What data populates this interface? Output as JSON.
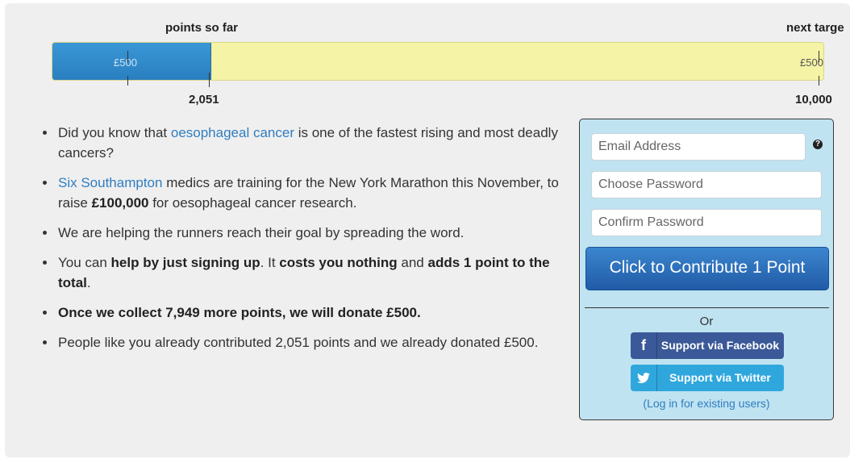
{
  "progress": {
    "label_left": "points so far",
    "label_right": "next targe",
    "fill_fraction": 0.205,
    "current_marker_label": "£500",
    "target_marker_label": "£500",
    "current_points": "2,051",
    "target_points": "10,000",
    "colors": {
      "fill": "#2a7fc0",
      "track": "#f5f3a6"
    }
  },
  "facts": [
    {
      "pre": "Did you know that ",
      "link": "oesophageal cancer",
      "post": " is one of the fastest rising and most deadly cancers?"
    },
    {
      "link": "Six Southampton",
      "post1": " medics are training for the New York Marathon this November, to raise ",
      "bold": "£100,000",
      "post2": " for oesophageal cancer research."
    },
    {
      "text": "We are helping the runners reach their goal by spreading the word."
    },
    {
      "pre": "You can ",
      "bold1": "help by just signing up",
      "mid1": ". It ",
      "bold2": "costs you nothing",
      "mid2": " and ",
      "bold3": "adds 1 point to the total",
      "post": "."
    },
    {
      "bold": "Once we collect 7,949 more points, we will donate £500."
    },
    {
      "text": "People like you already contributed 2,051 points and we already donated £500."
    }
  ],
  "signup": {
    "email_placeholder": "Email Address",
    "help_icon": "?",
    "password_placeholder": "Choose Password",
    "confirm_placeholder": "Confirm Password",
    "contribute_label": "Click to Contribute 1 Point",
    "or_label": "Or",
    "facebook_icon": "f",
    "facebook_label": "Support via Facebook",
    "twitter_icon": "twitter-bird",
    "twitter_label": "Support via Twitter",
    "login_link": "(Log in for existing users)"
  }
}
